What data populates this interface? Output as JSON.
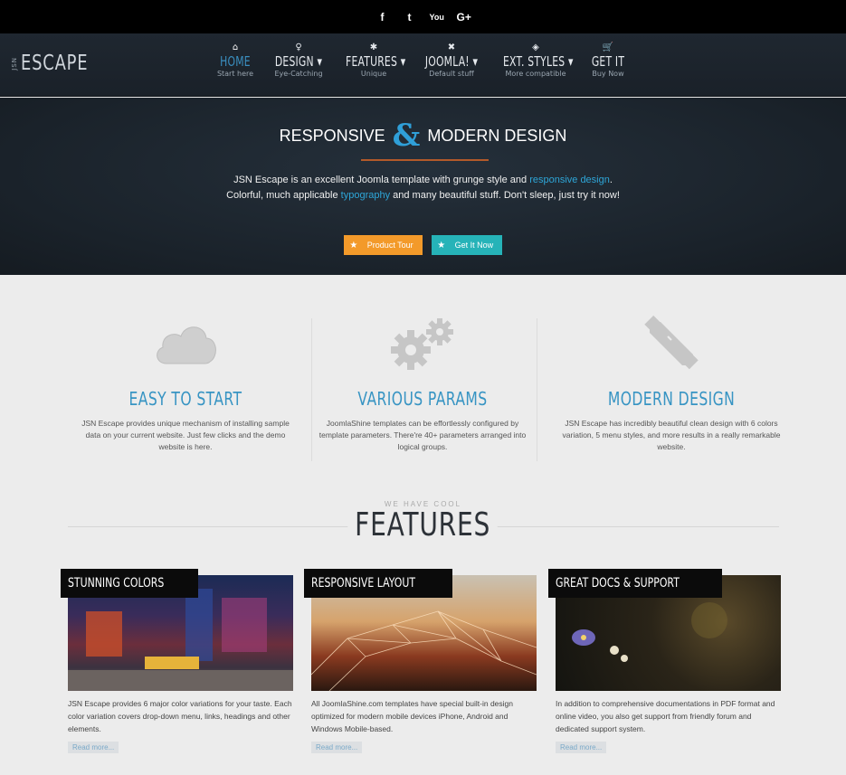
{
  "social": {
    "facebook": "f",
    "twitter": "t",
    "youtube": "You",
    "googleplus": "G+"
  },
  "logo": {
    "prefix": "JSN",
    "name": "ESCAPE"
  },
  "nav": [
    {
      "icon": "home-icon",
      "glyph": "⌂",
      "label": "HOME",
      "sub": "Start here"
    },
    {
      "icon": "bulb-icon",
      "glyph": "♀",
      "label": "DESIGN ▾",
      "sub": "Eye-Catching"
    },
    {
      "icon": "gear-icon",
      "glyph": "✱",
      "label": "FEATURES ▾",
      "sub": "Unique"
    },
    {
      "icon": "joomla-icon",
      "glyph": "✖",
      "label": "JOOMLA! ▾",
      "sub": "Default stuff"
    },
    {
      "icon": "cube-icon",
      "glyph": "◈",
      "label": "EXT. STYLES ▾",
      "sub": "More compatible"
    },
    {
      "icon": "cart-icon",
      "glyph": "▾",
      "label": "GET IT",
      "sub": "Buy Now"
    }
  ],
  "hero": {
    "word1": "RESPONSIVE",
    "amp": "&",
    "word2": "MODERN DESIGN",
    "text_a": "JSN Escape is an excellent Joomla template with grunge style and ",
    "link1": "responsive design",
    "text_b": ". Colorful, much applicable ",
    "link2": "typography",
    "text_c": " and many beautiful stuff. Don't sleep, just try it now!",
    "btn1": "Product Tour",
    "btn2": "Get It Now",
    "colors": {
      "orange": "#f39a2a",
      "teal": "#26b3b8",
      "link": "#2ea6d8"
    }
  },
  "features": [
    {
      "icon": "cloud-icon",
      "title": "EASY TO START",
      "desc": "JSN Escape provides unique mechanism of installing sample data on your current website. Just few clicks and the demo website is here."
    },
    {
      "icon": "gears-icon",
      "title": "VARIOUS PARAMS",
      "desc": "JoomlaShine templates can be effortlessly configured by template parameters. There're 40+ parameters arranged into logical groups."
    },
    {
      "icon": "pencil-ruler-icon",
      "title": "MODERN DESIGN",
      "desc": "JSN Escape has incredibly beautiful clean design with 6 colors variation, 5 menu styles, and more results in a really remarkable website."
    }
  ],
  "section": {
    "small": "WE HAVE COOL",
    "big": "FEATURES"
  },
  "cards": [
    {
      "tag": "STUNNING COLORS",
      "desc": "JSN Escape provides 6 major color variations for your taste. Each color variation covers drop-down menu, links, headings and other elements.",
      "more": "Read more..."
    },
    {
      "tag": "RESPONSIVE LAYOUT",
      "desc": "All JoomlaShine.com templates have special built-in design optimized for modern mobile devices iPhone, Android and Windows Mobile-based.",
      "more": "Read more..."
    },
    {
      "tag": "GREAT DOCS & SUPPORT",
      "desc": "In addition to comprehensive documentations in PDF format and online video, you also get support from friendly forum and dedicated support system.",
      "more": "Read more..."
    }
  ]
}
